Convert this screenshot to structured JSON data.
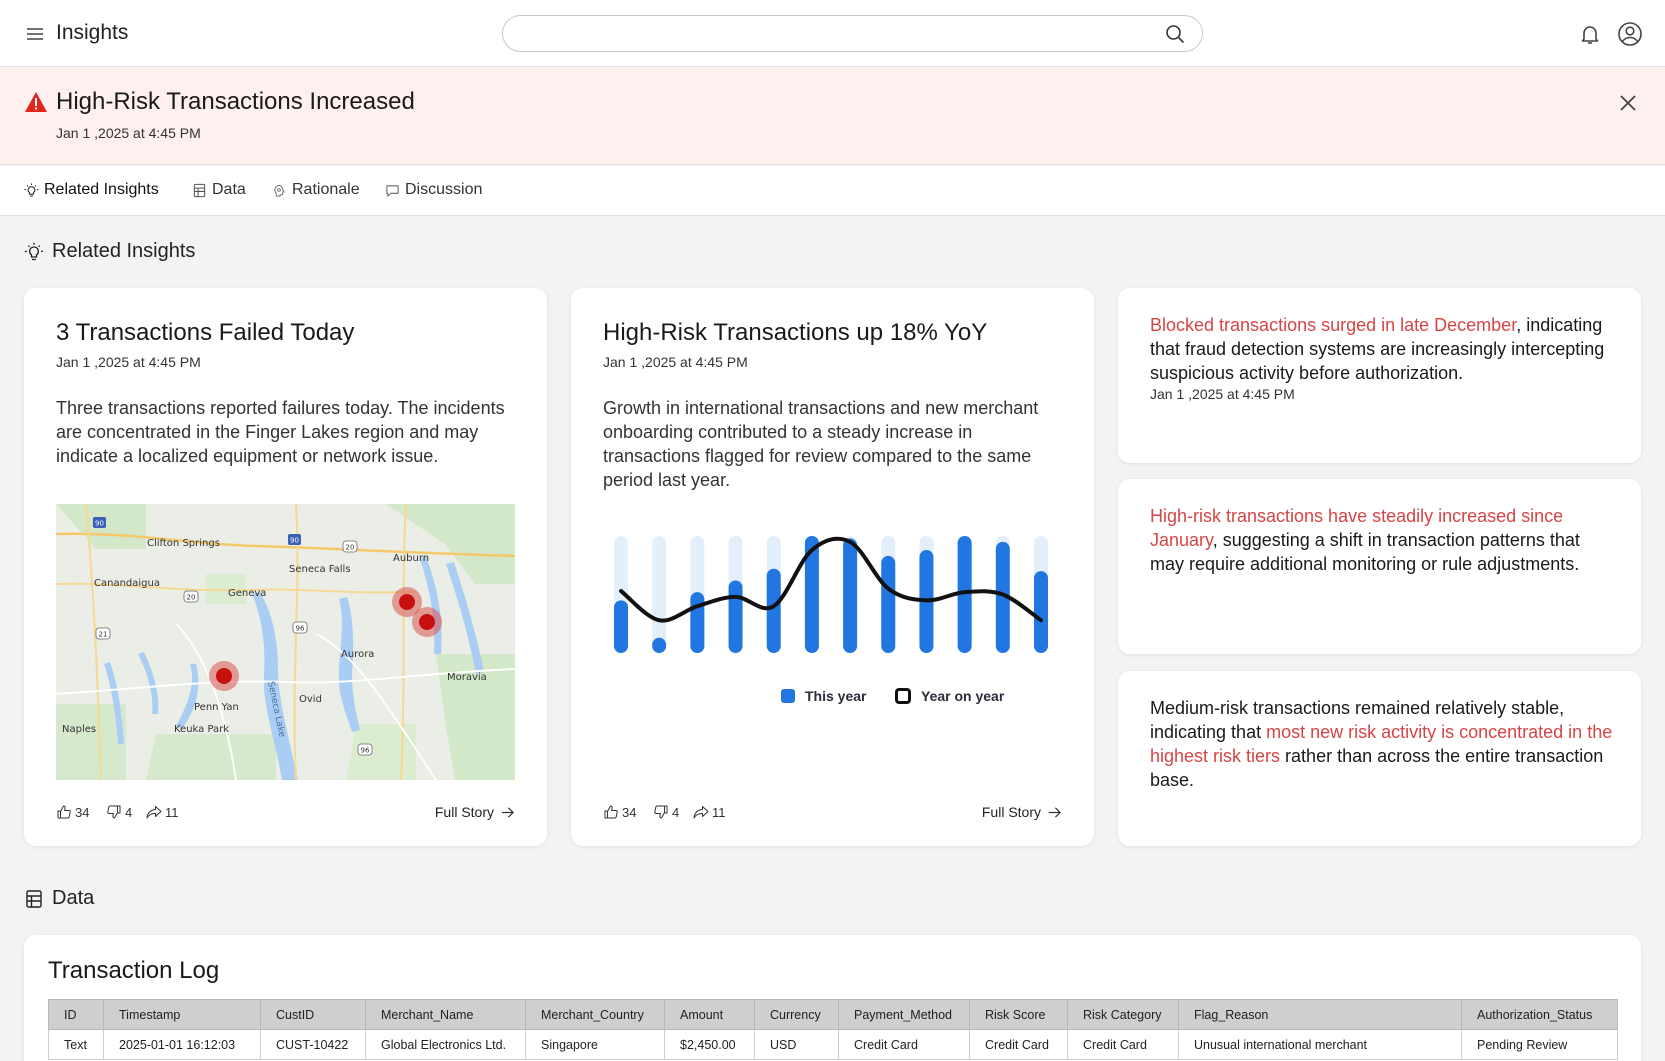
{
  "app": {
    "title": "Insights"
  },
  "search": {
    "placeholder": ""
  },
  "alert": {
    "title": "High-Risk Transactions Increased",
    "time": "Jan 1 ,2025 at 4:45 PM",
    "severity_color": "#e0261f"
  },
  "tabs": [
    {
      "label": "Related Insights",
      "icon": "lightbulb-icon",
      "active": true
    },
    {
      "label": "Data",
      "icon": "table-icon",
      "active": false
    },
    {
      "label": "Rationale",
      "icon": "brain-icon",
      "active": false
    },
    {
      "label": "Discussion",
      "icon": "chat-icon",
      "active": false
    }
  ],
  "related_section": {
    "title": "Related Insights"
  },
  "cards": [
    {
      "title": "3 Transactions Failed Today",
      "time": "Jan 1 ,2025 at 4:45 PM",
      "body": "Three transactions reported failures today. The incidents are concentrated in the Finger Lakes region and may indicate a localized equipment or network issue.",
      "likes": "34",
      "dislikes": "4",
      "shares": "11",
      "full_story": "Full Story"
    },
    {
      "title": "High-Risk Transactions up 18% YoY",
      "time": "Jan 1 ,2025 at 4:45 PM",
      "body": "Growth in international transactions and new merchant onboarding contributed to a steady increase in transactions flagged for review compared to the same period last year.",
      "likes": "34",
      "dislikes": "4",
      "shares": "11",
      "full_story": "Full Story"
    }
  ],
  "map": {
    "labels": [
      "Clifton Springs",
      "Seneca Falls",
      "Auburn",
      "Canandaigua",
      "Geneva",
      "Aurora",
      "Moravia",
      "Penn Yan",
      "Ovid",
      "Seneca Lake",
      "Naples",
      "Keuka Park"
    ],
    "shields": [
      "90",
      "90",
      "20",
      "20",
      "96",
      "21",
      "96"
    ],
    "markers": 3
  },
  "mini_cards": [
    {
      "highlight": "Blocked transactions surged in late December",
      "rest": ", indicating that fraud detection systems are increasingly intercepting suspicious activity before authorization.",
      "time": "Jan 1 ,2025 at 4:45 PM"
    },
    {
      "highlight": "High-risk transactions have steadily increased since January",
      "rest": ", suggesting a shift in transaction patterns that may require additional monitoring or rule adjustments."
    },
    {
      "pre": "Medium-risk transactions remained relatively stable, indicating that ",
      "highlight": "most new risk activity is concentrated in the highest risk tiers",
      "rest": " rather than across the entire transaction base."
    }
  ],
  "data_section": {
    "title": "Data"
  },
  "table": {
    "title": "Transaction Log",
    "columns": [
      "ID",
      "Timestamp",
      "CustID",
      "Merchant_Name",
      "Merchant_Country",
      "Amount",
      "Currency",
      "Payment_Method",
      "Risk Score",
      "Risk Category",
      "Flag_Reason",
      "Authorization_Status"
    ],
    "rows": [
      [
        "Text",
        "2025-01-01 16:12:03",
        "CUST-10422",
        "Global Electronics Ltd.",
        "Singapore",
        "$2,450.00",
        "USD",
        "Credit Card",
        "Credit Card",
        "Credit Card",
        "Unusual international merchant",
        "Pending Review"
      ]
    ]
  },
  "chart_data": {
    "type": "bar",
    "categories": [
      "",
      "",
      "",
      "",
      "",
      "",
      "",
      "",
      "",
      "",
      "",
      ""
    ],
    "series": [
      {
        "name": "This year",
        "values": [
          0.45,
          0.13,
          0.52,
          0.62,
          0.72,
          1.0,
          0.98,
          0.83,
          0.88,
          1.0,
          0.95,
          0.7
        ]
      },
      {
        "name": "Year on year",
        "values": [
          0.53,
          0.28,
          0.4,
          0.48,
          0.4,
          0.88,
          0.95,
          0.55,
          0.45,
          0.52,
          0.5,
          0.28
        ]
      }
    ],
    "background_values": [
      1,
      1,
      1,
      1,
      1,
      1,
      1,
      1,
      1,
      1,
      1,
      1
    ],
    "colors": {
      "this_year": "#2176e2",
      "background": "#e3f0fc",
      "line": "#111111"
    },
    "legend_position": "bottom-center"
  }
}
